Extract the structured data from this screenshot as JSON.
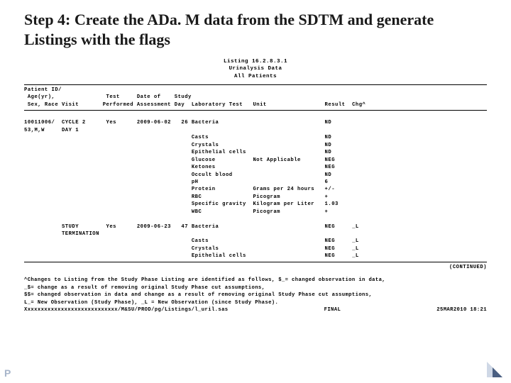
{
  "title": "Step 4: Create the ADa. M data from the SDTM and generate Listings with the flags",
  "listing_header": {
    "line1": "Listing 16.2.8.3.1",
    "line2": "Urinalysis Data",
    "line3": "All Patients"
  },
  "columns": {
    "c1a": "Patient ID/",
    "c1b": " Age(yr),",
    "c1c": " Sex, Race",
    "c2": "Visit",
    "c3a": "Test",
    "c3b": "Performed",
    "c4a": "Date of",
    "c4b": "Assessment",
    "c5a": "Study",
    "c5b": "Day",
    "c6": "Laboratory Test",
    "c7": "Unit",
    "c8": "Result",
    "c9": "Chg^"
  },
  "rows": [
    {
      "pid": "10011006/",
      "visit": "CYCLE 2",
      "test": "Yes",
      "date": "2009-06-02",
      "day": "26",
      "lab": "Bacteria",
      "unit": "",
      "result": "ND",
      "chg": ""
    },
    {
      "pid": "53,M,W",
      "visit": "DAY 1",
      "test": "",
      "date": "",
      "day": "",
      "lab": "",
      "unit": "",
      "result": "",
      "chg": ""
    },
    {
      "pid": "",
      "visit": "",
      "test": "",
      "date": "",
      "day": "",
      "lab": "Casts",
      "unit": "",
      "result": "ND",
      "chg": ""
    },
    {
      "pid": "",
      "visit": "",
      "test": "",
      "date": "",
      "day": "",
      "lab": "Crystals",
      "unit": "",
      "result": "ND",
      "chg": ""
    },
    {
      "pid": "",
      "visit": "",
      "test": "",
      "date": "",
      "day": "",
      "lab": "Epithelial cells",
      "unit": "",
      "result": "ND",
      "chg": ""
    },
    {
      "pid": "",
      "visit": "",
      "test": "",
      "date": "",
      "day": "",
      "lab": "Glucose",
      "unit": "Not Applicable",
      "result": "NEG",
      "chg": ""
    },
    {
      "pid": "",
      "visit": "",
      "test": "",
      "date": "",
      "day": "",
      "lab": "Ketones",
      "unit": "",
      "result": "NEG",
      "chg": ""
    },
    {
      "pid": "",
      "visit": "",
      "test": "",
      "date": "",
      "day": "",
      "lab": "Occult blood",
      "unit": "",
      "result": "ND",
      "chg": ""
    },
    {
      "pid": "",
      "visit": "",
      "test": "",
      "date": "",
      "day": "",
      "lab": "pH",
      "unit": "",
      "result": "6",
      "chg": ""
    },
    {
      "pid": "",
      "visit": "",
      "test": "",
      "date": "",
      "day": "",
      "lab": "Protein",
      "unit": "Grams per 24 hours",
      "result": "+/-",
      "chg": ""
    },
    {
      "pid": "",
      "visit": "",
      "test": "",
      "date": "",
      "day": "",
      "lab": "RBC",
      "unit": "Picogram",
      "result": "+",
      "chg": ""
    },
    {
      "pid": "",
      "visit": "",
      "test": "",
      "date": "",
      "day": "",
      "lab": "Specific gravity",
      "unit": "Kilogram per Liter",
      "result": "1.03",
      "chg": ""
    },
    {
      "pid": "",
      "visit": "",
      "test": "",
      "date": "",
      "day": "",
      "lab": "WBC",
      "unit": "Picogram",
      "result": "+",
      "chg": ""
    },
    {
      "pid": "",
      "visit": "",
      "test": "",
      "date": "",
      "day": "",
      "lab": "",
      "unit": "",
      "result": "",
      "chg": ""
    },
    {
      "pid": "",
      "visit": "STUDY",
      "test": "Yes",
      "date": "2009-06-23",
      "day": "47",
      "lab": "Bacteria",
      "unit": "",
      "result": "NEG",
      "chg": "_L"
    },
    {
      "pid": "",
      "visit": "TERMINATION",
      "test": "",
      "date": "",
      "day": "",
      "lab": "",
      "unit": "",
      "result": "",
      "chg": ""
    },
    {
      "pid": "",
      "visit": "",
      "test": "",
      "date": "",
      "day": "",
      "lab": "Casts",
      "unit": "",
      "result": "NEG",
      "chg": "_L"
    },
    {
      "pid": "",
      "visit": "",
      "test": "",
      "date": "",
      "day": "",
      "lab": "Crystals",
      "unit": "",
      "result": "NEG",
      "chg": "_L"
    },
    {
      "pid": "",
      "visit": "",
      "test": "",
      "date": "",
      "day": "",
      "lab": "Epithelial cells",
      "unit": "",
      "result": "NEG",
      "chg": "_L"
    }
  ],
  "continued": "(CONTINUED)",
  "footnotes": {
    "l1": "^Changes to Listing from the Study Phase Listing are identified as follows, $_= changed observation in data,",
    "l2": " _$= change as a result of removing original Study Phase cut assumptions,",
    "l3": "$$= changed observation in data and change as a result of removing original Study Phase cut assumptions,",
    "l4": "L_= New Observation (Study Phase), _L = New Observation (since Study Phase).",
    "path": "Xxxxxxxxxxxxxxxxxxxxxxxxxxxx/M&SU/PROD/pg/Listings/l_uril.sas",
    "status": "FINAL",
    "timestamp": "25MAR2010 18:21"
  },
  "logo": "P"
}
